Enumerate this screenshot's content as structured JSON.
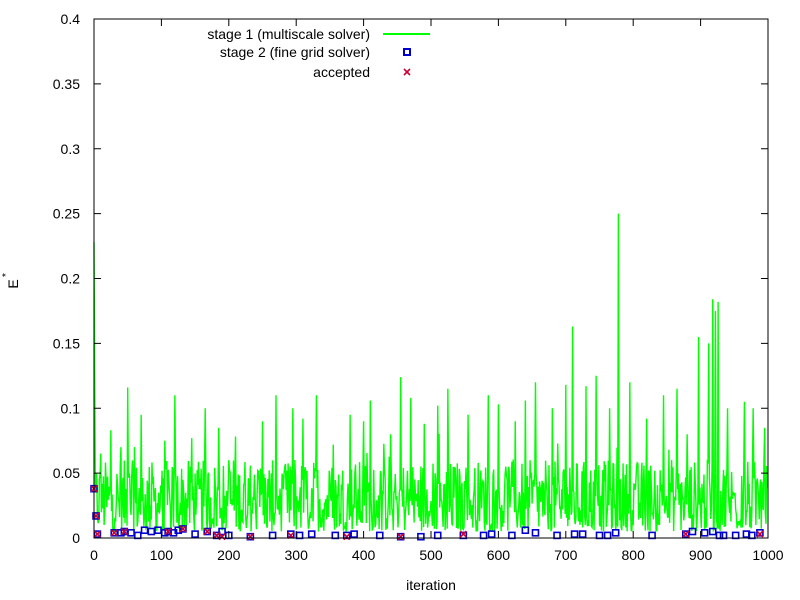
{
  "chart_data": {
    "type": "line",
    "xlabel": "iteration",
    "ylabel": "E",
    "ylabel_superscript": "*",
    "xlim": [
      0,
      1000
    ],
    "ylim": [
      0,
      0.4
    ],
    "x_ticks": [
      "0",
      "100",
      "200",
      "300",
      "400",
      "500",
      "600",
      "700",
      "800",
      "900",
      "1000"
    ],
    "y_ticks": [
      "0",
      "0.05",
      "0.1",
      "0.15",
      "0.2",
      "0.25",
      "0.3",
      "0.35",
      "0.4"
    ],
    "grid": false,
    "legend_position": "top-center",
    "colors": {
      "stage1": "#00ff00",
      "stage2": "#0000cc",
      "accepted": "#cc0033"
    },
    "series": [
      {
        "name": "stage 1 (multiscale solver)",
        "kind": "line",
        "generated": true,
        "n": 1000,
        "baseline_range": [
          0.005,
          0.06
        ],
        "spikes": [
          [
            0,
            0.228
          ],
          [
            1,
            0.135
          ],
          [
            3,
            0.05
          ],
          [
            10,
            0.065
          ],
          [
            25,
            0.083
          ],
          [
            40,
            0.07
          ],
          [
            50,
            0.116
          ],
          [
            60,
            0.07
          ],
          [
            70,
            0.095
          ],
          [
            105,
            0.075
          ],
          [
            120,
            0.11
          ],
          [
            145,
            0.077
          ],
          [
            165,
            0.1
          ],
          [
            185,
            0.085
          ],
          [
            200,
            0.06
          ],
          [
            250,
            0.09
          ],
          [
            270,
            0.11
          ],
          [
            295,
            0.1
          ],
          [
            310,
            0.092
          ],
          [
            330,
            0.11
          ],
          [
            355,
            0.072
          ],
          [
            380,
            0.095
          ],
          [
            400,
            0.09
          ],
          [
            410,
            0.106
          ],
          [
            440,
            0.08
          ],
          [
            455,
            0.124
          ],
          [
            470,
            0.108
          ],
          [
            490,
            0.088
          ],
          [
            510,
            0.102
          ],
          [
            525,
            0.115
          ],
          [
            555,
            0.095
          ],
          [
            585,
            0.11
          ],
          [
            600,
            0.103
          ],
          [
            625,
            0.09
          ],
          [
            640,
            0.106
          ],
          [
            655,
            0.12
          ],
          [
            680,
            0.1
          ],
          [
            700,
            0.118
          ],
          [
            710,
            0.163
          ],
          [
            730,
            0.117
          ],
          [
            745,
            0.125
          ],
          [
            765,
            0.1
          ],
          [
            778,
            0.25
          ],
          [
            795,
            0.12
          ],
          [
            820,
            0.092
          ],
          [
            845,
            0.11
          ],
          [
            865,
            0.115
          ],
          [
            880,
            0.08
          ],
          [
            897,
            0.155
          ],
          [
            912,
            0.15
          ],
          [
            918,
            0.184
          ],
          [
            922,
            0.175
          ],
          [
            926,
            0.182
          ],
          [
            940,
            0.1
          ],
          [
            965,
            0.105
          ],
          [
            978,
            0.1
          ],
          [
            995,
            0.085
          ]
        ]
      },
      {
        "name": "stage 2 (fine grid solver)",
        "kind": "points",
        "marker": "square",
        "points": [
          [
            0,
            0.038
          ],
          [
            3,
            0.017
          ],
          [
            5,
            0.003
          ],
          [
            30,
            0.004
          ],
          [
            40,
            0.004
          ],
          [
            45,
            0.005
          ],
          [
            55,
            0.004
          ],
          [
            65,
            0.002
          ],
          [
            75,
            0.006
          ],
          [
            85,
            0.005
          ],
          [
            95,
            0.006
          ],
          [
            105,
            0.004
          ],
          [
            110,
            0.005
          ],
          [
            118,
            0.004
          ],
          [
            125,
            0.006
          ],
          [
            132,
            0.007
          ],
          [
            150,
            0.003
          ],
          [
            168,
            0.005
          ],
          [
            182,
            0.002
          ],
          [
            190,
            0.005
          ],
          [
            200,
            0.002
          ],
          [
            232,
            0.001
          ],
          [
            265,
            0.002
          ],
          [
            292,
            0.003
          ],
          [
            305,
            0.002
          ],
          [
            323,
            0.003
          ],
          [
            358,
            0.002
          ],
          [
            375,
            0.002
          ],
          [
            386,
            0.003
          ],
          [
            424,
            0.002
          ],
          [
            455,
            0.001
          ],
          [
            485,
            0.001
          ],
          [
            510,
            0.002
          ],
          [
            548,
            0.002
          ],
          [
            578,
            0.002
          ],
          [
            590,
            0.003
          ],
          [
            620,
            0.002
          ],
          [
            640,
            0.006
          ],
          [
            655,
            0.004
          ],
          [
            687,
            0.002
          ],
          [
            713,
            0.003
          ],
          [
            725,
            0.003
          ],
          [
            750,
            0.002
          ],
          [
            762,
            0.002
          ],
          [
            774,
            0.004
          ],
          [
            828,
            0.002
          ],
          [
            878,
            0.003
          ],
          [
            888,
            0.005
          ],
          [
            906,
            0.004
          ],
          [
            918,
            0.005
          ],
          [
            928,
            0.002
          ],
          [
            934,
            0.002
          ],
          [
            952,
            0.002
          ],
          [
            968,
            0.003
          ],
          [
            976,
            0.002
          ],
          [
            988,
            0.004
          ]
        ]
      },
      {
        "name": "accepted",
        "kind": "points",
        "marker": "x",
        "points": [
          [
            0,
            0.038
          ],
          [
            3,
            0.017
          ],
          [
            5,
            0.003
          ],
          [
            30,
            0.004
          ],
          [
            45,
            0.005
          ],
          [
            110,
            0.005
          ],
          [
            132,
            0.007
          ],
          [
            168,
            0.005
          ],
          [
            182,
            0.002
          ],
          [
            190,
            0.001
          ],
          [
            232,
            0.001
          ],
          [
            292,
            0.002
          ],
          [
            375,
            0.001
          ],
          [
            455,
            0.001
          ],
          [
            548,
            0.003
          ],
          [
            878,
            0.003
          ],
          [
            988,
            0.003
          ]
        ]
      }
    ]
  }
}
